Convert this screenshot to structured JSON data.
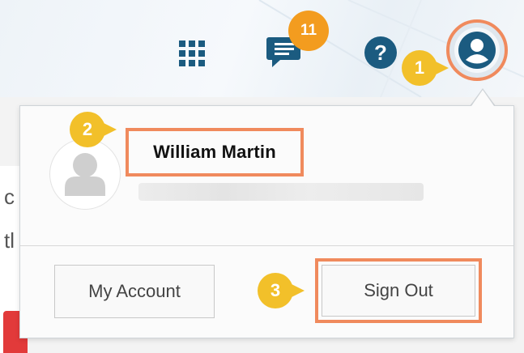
{
  "header": {
    "notification_count": "11",
    "icons": [
      "apps-grid-icon",
      "chat-icon",
      "help-icon",
      "user-icon"
    ]
  },
  "background": {
    "text_fragment_1": "c",
    "text_fragment_2": "tl"
  },
  "callouts": {
    "step1": "1",
    "step2": "2",
    "step3": "3"
  },
  "user_menu": {
    "user_name": "William Martin",
    "my_account_label": "My Account",
    "sign_out_label": "Sign Out"
  },
  "colors": {
    "accent_icon": "#1b5b80",
    "highlight": "#f08a5d",
    "callout": "#f2c02a",
    "badge": "#f39c1f"
  }
}
